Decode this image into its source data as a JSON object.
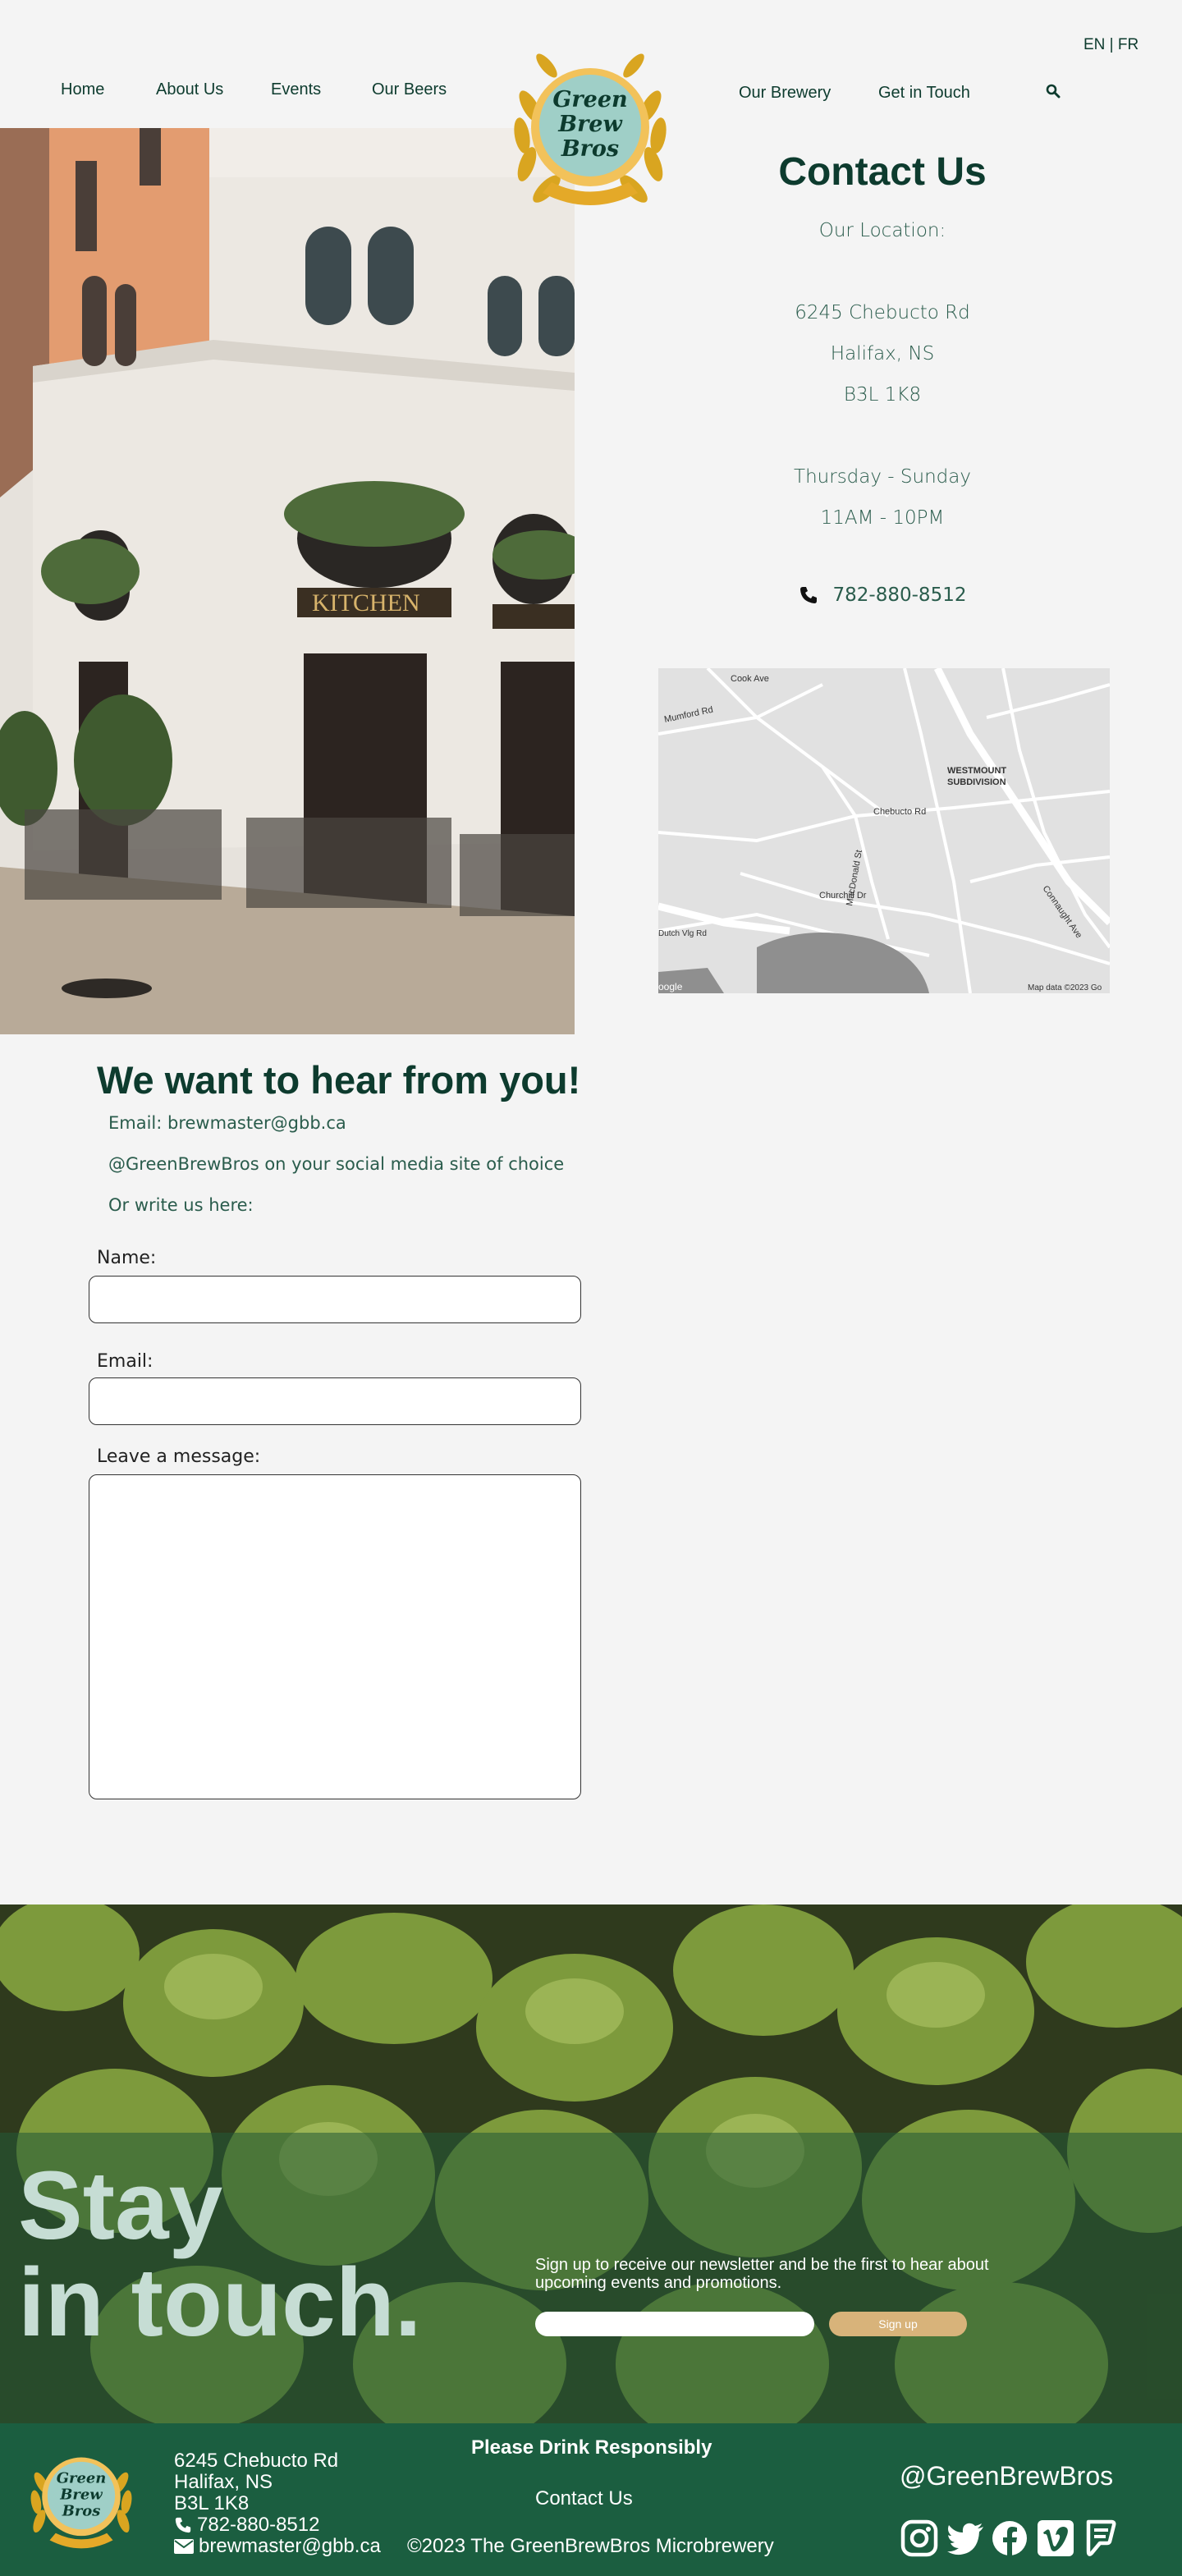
{
  "header": {
    "lang": "EN | FR",
    "nav_left": [
      "Home",
      "About Us",
      "Events",
      "Our Beers"
    ],
    "nav_right": [
      "Our Brewery",
      "Get in Touch"
    ],
    "logo_text": [
      "Green",
      "Brew",
      "Bros"
    ]
  },
  "contact": {
    "title": "Contact Us",
    "location_label": "Our Location:",
    "address_line1": "6245 Chebucto Rd",
    "address_line2": "Halifax, NS",
    "address_line3": "B3L 1K8",
    "hours_days": "Thursday - Sunday",
    "hours_time": "11AM - 10PM",
    "phone": "782-880-8512"
  },
  "map": {
    "labels": [
      "Cook Ave",
      "Mumford Rd",
      "Chebucto Rd",
      "WESTMOUNT",
      "SUBDIVISION",
      "MacDonald St",
      "Connaught Ave",
      "Churchill Dr",
      "Dutch Vlg Rd",
      "Map data ©2023 Go",
      "oogle"
    ]
  },
  "form": {
    "title": "We want to hear from you!",
    "email_line": "Email: brewmaster@gbb.ca",
    "social_line": "@GreenBrewBros on your social media site of choice",
    "write_line": "Or write us here:",
    "name_label": "Name:",
    "email_label": "Email:",
    "message_label": "Leave a message:"
  },
  "newsletter": {
    "title_line1": "Stay",
    "title_line2": "in touch.",
    "text": "Sign up to receive our newsletter and be the first to hear about upcoming events and promotions.",
    "button": "Sign up"
  },
  "footer": {
    "address_line1": "6245 Chebucto Rd",
    "address_line2": "Halifax, NS",
    "address_line3": "B3L 1K8",
    "phone": "782-880-8512",
    "email": "brewmaster@gbb.ca",
    "drink_responsibly": "Please Drink Responsibly",
    "contact_link": "Contact Us",
    "copyright": "©2023 The GreenBrewBros Microbrewery",
    "handle": "@GreenBrewBros",
    "social_icons": [
      "instagram-icon",
      "twitter-icon",
      "facebook-icon",
      "vimeo-icon",
      "foursquare-icon"
    ]
  },
  "colors": {
    "primary": "#0d3b2e",
    "footer": "#1b5e40",
    "accent": "#d8b37a",
    "background": "#f4f4f4"
  }
}
